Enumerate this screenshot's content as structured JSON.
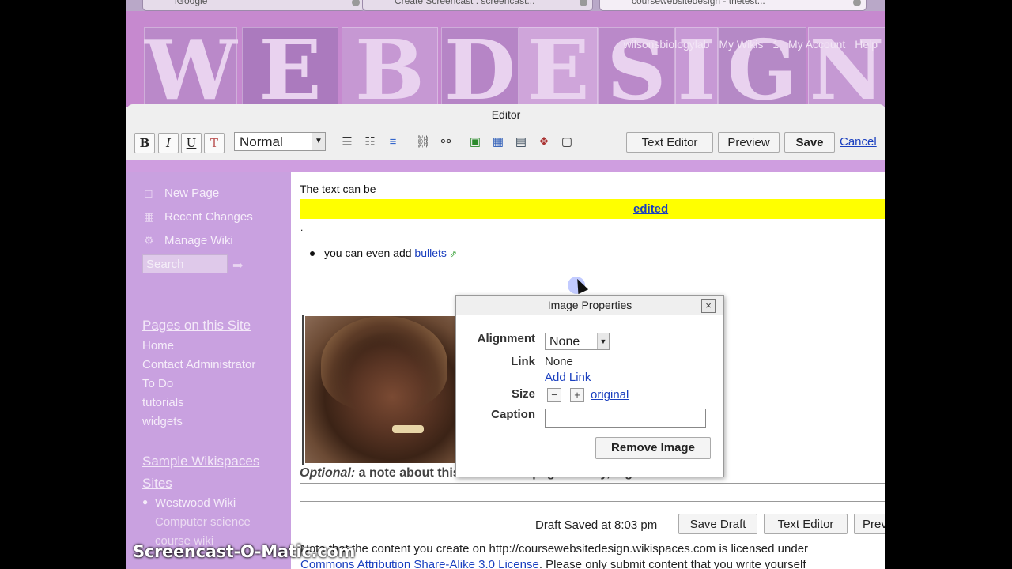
{
  "browser": {
    "tabs": [
      "iGoogle",
      "Create Screencast : screencast...",
      "coursewebsitedesign - thetest..."
    ]
  },
  "banner": {
    "letters": [
      "W",
      "E",
      "B",
      "D",
      "E",
      "S",
      "I",
      "G",
      "N"
    ],
    "user": "wilsonsbiologylab",
    "my_wikis": "My Wikis",
    "mail_count": "1",
    "my_account": "My Account",
    "help": "Help"
  },
  "editor": {
    "title": "Editor",
    "bold": "B",
    "italic": "I",
    "underline": "U",
    "format_select": "Normal",
    "text_editor": "Text Editor",
    "preview": "Preview",
    "save": "Save",
    "cancel": "Cancel"
  },
  "sidebar": {
    "new_page": "New Page",
    "recent_changes": "Recent Changes",
    "manage_wiki": "Manage Wiki",
    "search_placeholder": "Search",
    "pages_heading": "Pages on this Site",
    "pages": [
      "Home",
      "Contact Administrator",
      "To Do",
      "tutorials",
      "widgets"
    ],
    "sample_heading_1": "Sample Wikispaces",
    "sample_heading_2": "Sites",
    "sample_item": "Westwood Wiki",
    "sample_sub_1": "Computer science",
    "sample_sub_2": "course wiki"
  },
  "content": {
    "line1": "The text can be",
    "edited_link": "edited",
    "dot": ".",
    "bullet_prefix": "you can even add ",
    "bullet_link": "bullets",
    "note_label": "Optional:",
    "note_text": " a note about this edit for the page history, log",
    "draft_status": "Draft Saved at 8:03 pm",
    "save_draft": "Save Draft",
    "text_editor": "Text Editor",
    "preview_partial": "Prev",
    "license_line1": "Note that the content you create on http://coursewebsitedesign.wikispaces.com is licensed under",
    "license_link": "Commons Attribution Share-Alike 3.0 License",
    "license_line2_rest": ". Please only submit content that you write yourself"
  },
  "dialog": {
    "title": "Image Properties",
    "alignment_label": "Alignment",
    "alignment_value": "None",
    "link_label": "Link",
    "link_value": "None",
    "add_link": "Add Link",
    "size_label": "Size",
    "size_minus": "−",
    "size_plus": "+",
    "size_original": "original",
    "caption_label": "Caption",
    "caption_value": "",
    "remove_image": "Remove Image"
  },
  "watermark": "Screencast-O-Matic.com"
}
